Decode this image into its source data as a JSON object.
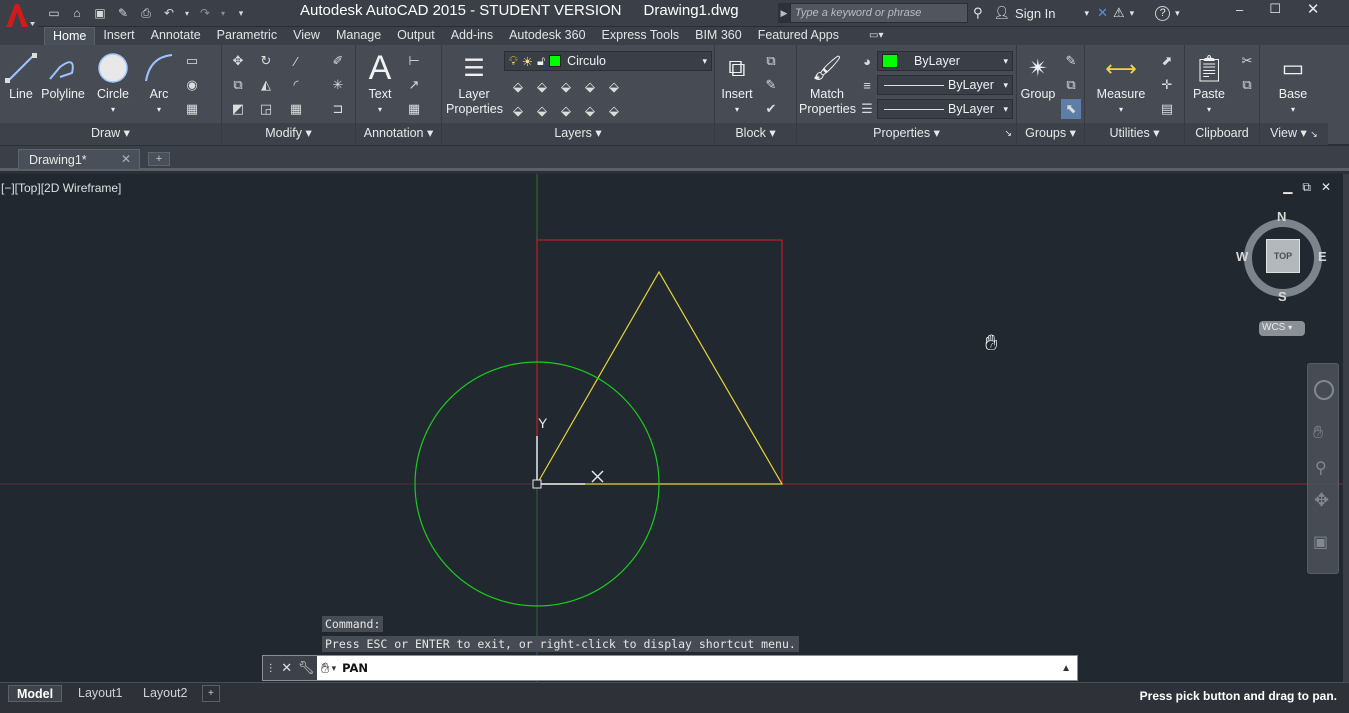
{
  "app": {
    "title": "Autodesk AutoCAD 2015 - STUDENT VERSION",
    "filename": "Drawing1.dwg",
    "search_placeholder": "Type a keyword or phrase",
    "sign_in": "Sign In"
  },
  "tabs": [
    "Home",
    "Insert",
    "Annotate",
    "Parametric",
    "View",
    "Manage",
    "Output",
    "Add-ins",
    "Autodesk 360",
    "Express Tools",
    "BIM 360",
    "Featured Apps"
  ],
  "ribbon": {
    "draw": {
      "title": "Draw",
      "line": "Line",
      "polyline": "Polyline",
      "circle": "Circle",
      "arc": "Arc"
    },
    "modify": {
      "title": "Modify"
    },
    "annotation": {
      "title": "Annotation",
      "text": "Text"
    },
    "layers": {
      "title": "Layers",
      "layer_props_1": "Layer",
      "layer_props_2": "Properties",
      "current_layer": "Circulo"
    },
    "block": {
      "title": "Block",
      "insert": "Insert"
    },
    "properties": {
      "title": "Properties",
      "match_1": "Match",
      "match_2": "Properties",
      "color": "ByLayer",
      "linetype": "ByLayer",
      "lineweight": "ByLayer"
    },
    "groups": {
      "title": "Groups",
      "group": "Group"
    },
    "utilities": {
      "title": "Utilities",
      "measure": "Measure"
    },
    "clipboard": {
      "title": "Clipboard",
      "paste": "Paste"
    },
    "view": {
      "title": "View",
      "base": "Base"
    }
  },
  "file_tab": {
    "name": "Drawing1*"
  },
  "viewport": {
    "label": "[−][Top][2D Wireframe]",
    "viewcube": {
      "n": "N",
      "s": "S",
      "e": "E",
      "w": "W",
      "face": "TOP",
      "ucs": "WCS"
    },
    "ucs_y": "Y"
  },
  "command": {
    "history_1": "Command:",
    "history_2": "Press ESC or ENTER to exit, or right-click to display shortcut menu.",
    "current": "PAN"
  },
  "layout_tabs": [
    "Model",
    "Layout1",
    "Layout2"
  ],
  "status_text": "Press pick button and drag to pan.",
  "colors": {
    "accent_green": "#00c000",
    "layer_swatch": "#00ff00",
    "red_frame": "#e01b1b",
    "triangle": "#e8d43a",
    "circle": "#19cc19"
  }
}
